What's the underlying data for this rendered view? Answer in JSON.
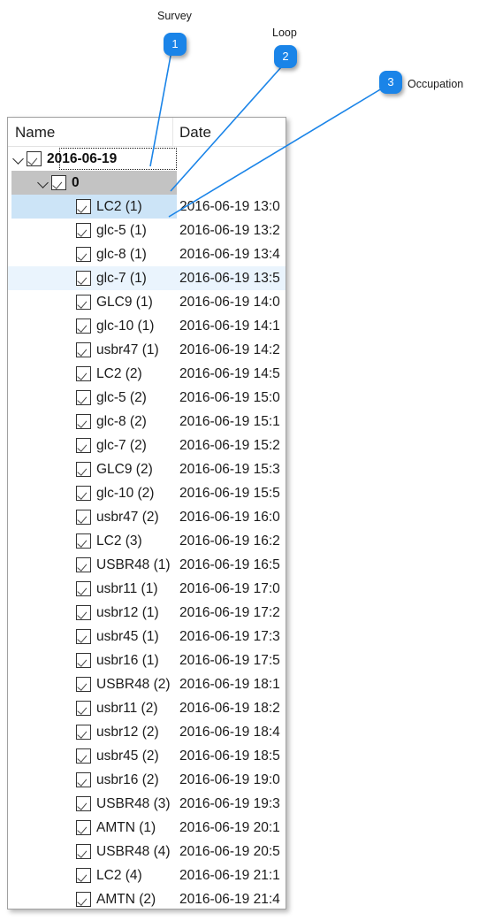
{
  "callouts": [
    {
      "number": "1",
      "label": "Survey"
    },
    {
      "number": "2",
      "label": "Loop"
    },
    {
      "number": "3",
      "label": "Occupation"
    }
  ],
  "tree": {
    "columns": {
      "name": "Name",
      "date": "Date"
    },
    "rows": [
      {
        "level": 0,
        "chevron": "expanded",
        "checked": true,
        "name": "2016-06-19",
        "date": "",
        "bold": true,
        "focus": true,
        "state": "none"
      },
      {
        "level": 1,
        "chevron": "expanded",
        "checked": true,
        "name": "0",
        "date": "",
        "bold": true,
        "focus": false,
        "state": "sel-gray"
      },
      {
        "level": 2,
        "chevron": "none",
        "checked": true,
        "name": "LC2 (1)",
        "date": "2016-06-19 13:0",
        "bold": false,
        "focus": false,
        "state": "sel-blue"
      },
      {
        "level": 2,
        "chevron": "none",
        "checked": true,
        "name": "glc-5 (1)",
        "date": "2016-06-19 13:2",
        "bold": false,
        "focus": false,
        "state": "none"
      },
      {
        "level": 2,
        "chevron": "none",
        "checked": true,
        "name": "glc-8 (1)",
        "date": "2016-06-19 13:4",
        "bold": false,
        "focus": false,
        "state": "none"
      },
      {
        "level": 2,
        "chevron": "none",
        "checked": true,
        "name": "glc-7 (1)",
        "date": "2016-06-19 13:5",
        "bold": false,
        "focus": false,
        "state": "hover"
      },
      {
        "level": 2,
        "chevron": "none",
        "checked": true,
        "name": "GLC9 (1)",
        "date": "2016-06-19 14:0",
        "bold": false,
        "focus": false,
        "state": "none"
      },
      {
        "level": 2,
        "chevron": "none",
        "checked": true,
        "name": "glc-10 (1)",
        "date": "2016-06-19 14:1",
        "bold": false,
        "focus": false,
        "state": "none"
      },
      {
        "level": 2,
        "chevron": "none",
        "checked": true,
        "name": "usbr47 (1)",
        "date": "2016-06-19 14:2",
        "bold": false,
        "focus": false,
        "state": "none"
      },
      {
        "level": 2,
        "chevron": "none",
        "checked": true,
        "name": "LC2 (2)",
        "date": "2016-06-19 14:5",
        "bold": false,
        "focus": false,
        "state": "none"
      },
      {
        "level": 2,
        "chevron": "none",
        "checked": true,
        "name": "glc-5 (2)",
        "date": "2016-06-19 15:0",
        "bold": false,
        "focus": false,
        "state": "none"
      },
      {
        "level": 2,
        "chevron": "none",
        "checked": true,
        "name": "glc-8 (2)",
        "date": "2016-06-19 15:1",
        "bold": false,
        "focus": false,
        "state": "none"
      },
      {
        "level": 2,
        "chevron": "none",
        "checked": true,
        "name": "glc-7 (2)",
        "date": "2016-06-19 15:2",
        "bold": false,
        "focus": false,
        "state": "none"
      },
      {
        "level": 2,
        "chevron": "none",
        "checked": true,
        "name": "GLC9 (2)",
        "date": "2016-06-19 15:3",
        "bold": false,
        "focus": false,
        "state": "none"
      },
      {
        "level": 2,
        "chevron": "none",
        "checked": true,
        "name": "glc-10 (2)",
        "date": "2016-06-19 15:5",
        "bold": false,
        "focus": false,
        "state": "none"
      },
      {
        "level": 2,
        "chevron": "none",
        "checked": true,
        "name": "usbr47 (2)",
        "date": "2016-06-19 16:0",
        "bold": false,
        "focus": false,
        "state": "none"
      },
      {
        "level": 2,
        "chevron": "none",
        "checked": true,
        "name": "LC2 (3)",
        "date": "2016-06-19 16:2",
        "bold": false,
        "focus": false,
        "state": "none"
      },
      {
        "level": 2,
        "chevron": "none",
        "checked": true,
        "name": "USBR48 (1)",
        "date": "2016-06-19 16:5",
        "bold": false,
        "focus": false,
        "state": "none"
      },
      {
        "level": 2,
        "chevron": "none",
        "checked": true,
        "name": "usbr11 (1)",
        "date": "2016-06-19 17:0",
        "bold": false,
        "focus": false,
        "state": "none"
      },
      {
        "level": 2,
        "chevron": "none",
        "checked": true,
        "name": "usbr12 (1)",
        "date": "2016-06-19 17:2",
        "bold": false,
        "focus": false,
        "state": "none"
      },
      {
        "level": 2,
        "chevron": "none",
        "checked": true,
        "name": "usbr45 (1)",
        "date": "2016-06-19 17:3",
        "bold": false,
        "focus": false,
        "state": "none"
      },
      {
        "level": 2,
        "chevron": "none",
        "checked": true,
        "name": "usbr16 (1)",
        "date": "2016-06-19 17:5",
        "bold": false,
        "focus": false,
        "state": "none"
      },
      {
        "level": 2,
        "chevron": "none",
        "checked": true,
        "name": "USBR48 (2)",
        "date": "2016-06-19 18:1",
        "bold": false,
        "focus": false,
        "state": "none"
      },
      {
        "level": 2,
        "chevron": "none",
        "checked": true,
        "name": "usbr11 (2)",
        "date": "2016-06-19 18:2",
        "bold": false,
        "focus": false,
        "state": "none"
      },
      {
        "level": 2,
        "chevron": "none",
        "checked": true,
        "name": "usbr12 (2)",
        "date": "2016-06-19 18:4",
        "bold": false,
        "focus": false,
        "state": "none"
      },
      {
        "level": 2,
        "chevron": "none",
        "checked": true,
        "name": "usbr45 (2)",
        "date": "2016-06-19 18:5",
        "bold": false,
        "focus": false,
        "state": "none"
      },
      {
        "level": 2,
        "chevron": "none",
        "checked": true,
        "name": "usbr16 (2)",
        "date": "2016-06-19 19:0",
        "bold": false,
        "focus": false,
        "state": "none"
      },
      {
        "level": 2,
        "chevron": "none",
        "checked": true,
        "name": "USBR48 (3)",
        "date": "2016-06-19 19:3",
        "bold": false,
        "focus": false,
        "state": "none"
      },
      {
        "level": 2,
        "chevron": "none",
        "checked": true,
        "name": "AMTN (1)",
        "date": "2016-06-19 20:1",
        "bold": false,
        "focus": false,
        "state": "none"
      },
      {
        "level": 2,
        "chevron": "none",
        "checked": true,
        "name": "USBR48 (4)",
        "date": "2016-06-19 20:5",
        "bold": false,
        "focus": false,
        "state": "none"
      },
      {
        "level": 2,
        "chevron": "none",
        "checked": true,
        "name": "LC2 (4)",
        "date": "2016-06-19 21:1",
        "bold": false,
        "focus": false,
        "state": "none"
      },
      {
        "level": 2,
        "chevron": "none",
        "checked": true,
        "name": "AMTN (2)",
        "date": "2016-06-19 21:4",
        "bold": false,
        "focus": false,
        "state": "none"
      }
    ]
  },
  "colors": {
    "badge": "#1a84e8",
    "leader_line": "#1a84e8",
    "selection_gray": "#c3c3c3",
    "selection_blue": "#cce4f7",
    "hover_blue": "#eaf4fd"
  }
}
